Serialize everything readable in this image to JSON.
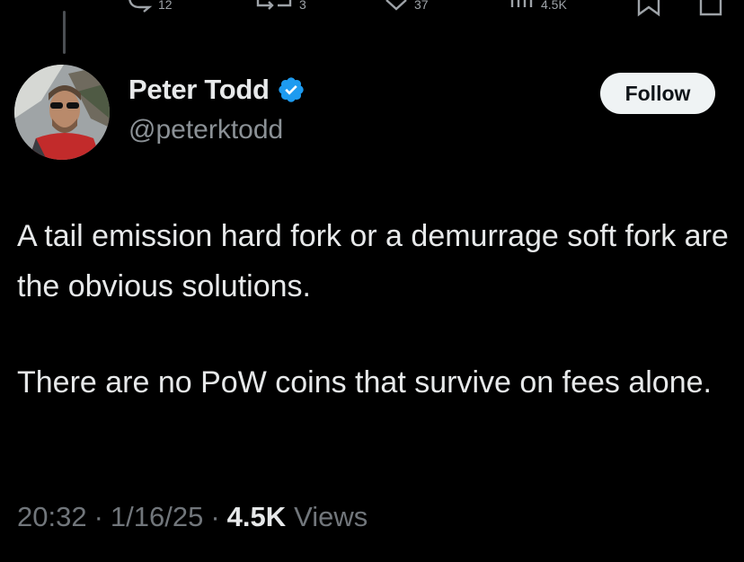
{
  "action_bar": {
    "reply_count": "12",
    "repost_count": "3",
    "like_count": "37",
    "views_count": "4.5K"
  },
  "tweet": {
    "author_name": "Peter Todd",
    "author_handle": "@peterktodd",
    "verified": true,
    "follow_label": "Follow",
    "paragraphs": [
      "A tail emission hard fork or a demurrage soft fork are the obvious solutions.",
      "There are no PoW coins that survive on fees alone."
    ],
    "time": "20:32",
    "date": "1/16/25",
    "views_count": "4.5K",
    "views_label": "Views"
  },
  "colors": {
    "background": "#000000",
    "text": "#e7e9ea",
    "muted": "#71767b",
    "verified_blue": "#1d9bf0",
    "button_bg": "#eff3f4"
  },
  "icons": [
    "reply-icon",
    "repost-icon",
    "like-icon",
    "views-icon",
    "bookmark-icon",
    "share-icon",
    "verified-badge-icon"
  ]
}
